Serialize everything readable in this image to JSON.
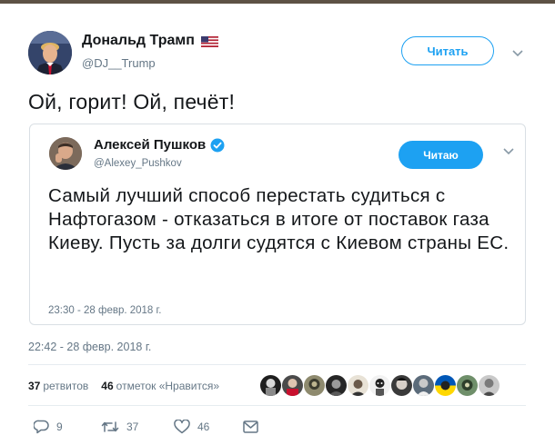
{
  "author": {
    "name": "Дональд Трамп",
    "handle": "@DJ__Trump",
    "follow_label": "Читать",
    "flag_icon": "us-flag-icon"
  },
  "tweet": {
    "text": "Ой, горит! Ой, печёт!",
    "timestamp": "22:42 - 28 февр. 2018 г."
  },
  "quoted": {
    "name": "Алексей Пушков",
    "handle": "@Alexey_Pushkov",
    "following_label": "Читаю",
    "text": "Самый лучший способ перестать судиться с Нафтогазом - отказаться в итоге от поставок газа Киеву. Пусть за долги судятся с Киевом страны ЕС.",
    "timestamp": "23:30 - 28 февр. 2018 г."
  },
  "stats": {
    "retweets_count": "37",
    "retweets_label": "ретвитов",
    "likes_count": "46",
    "likes_label": "отметок «Нравится»"
  },
  "actions": {
    "reply_count": "9",
    "retweet_count": "37",
    "like_count": "46"
  },
  "colors": {
    "accent": "#1da1f2",
    "muted": "#657786",
    "text": "#14171a"
  }
}
